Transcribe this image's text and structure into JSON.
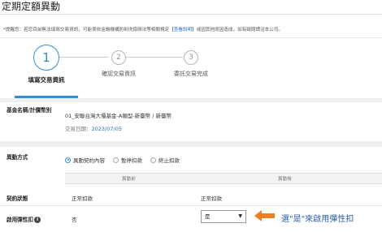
{
  "page_title": "定期定額異動",
  "notice": {
    "text_before": "*提醒您：若您目前無法填寫交易資訊，可能係依金融機構防制洗錢辦法等相關規定",
    "link": "【查看說明】",
    "text_after": "或因其他原因造成，如有疑問請洽本公司。"
  },
  "steps": [
    {
      "number": "1",
      "label": "填寫交易資訊",
      "active": true
    },
    {
      "number": "2",
      "label": "確認交易資訊",
      "active": false
    },
    {
      "number": "3",
      "label": "委託交易完成",
      "active": false
    }
  ],
  "fund": {
    "label": "基金名稱/計價幣別",
    "value": "01_安聯台灣大壩基金-A類型-新臺幣 / 新臺幣",
    "date_label": "交易日期：",
    "date_value": "2023/07/05"
  },
  "change_method": {
    "label": "異動方式",
    "options": [
      {
        "label": "異動契約內容",
        "selected": true
      },
      {
        "label": "暫停扣款",
        "selected": false
      },
      {
        "label": "終止扣款",
        "selected": false
      }
    ]
  },
  "table": {
    "col_before": "異動前",
    "col_after": "異動後",
    "rows": [
      {
        "label": "契約狀態",
        "before": "正常扣款",
        "after": "正常扣款"
      },
      {
        "label": "啟用彈性扣",
        "before": "否",
        "after": "是"
      }
    ]
  },
  "annotation": {
    "text": "選\"是\"來啟用彈性扣",
    "color": "#2a5ea8",
    "arrow_color": "#f07d1e"
  },
  "colors": {
    "accent": "#2f8ed8"
  }
}
